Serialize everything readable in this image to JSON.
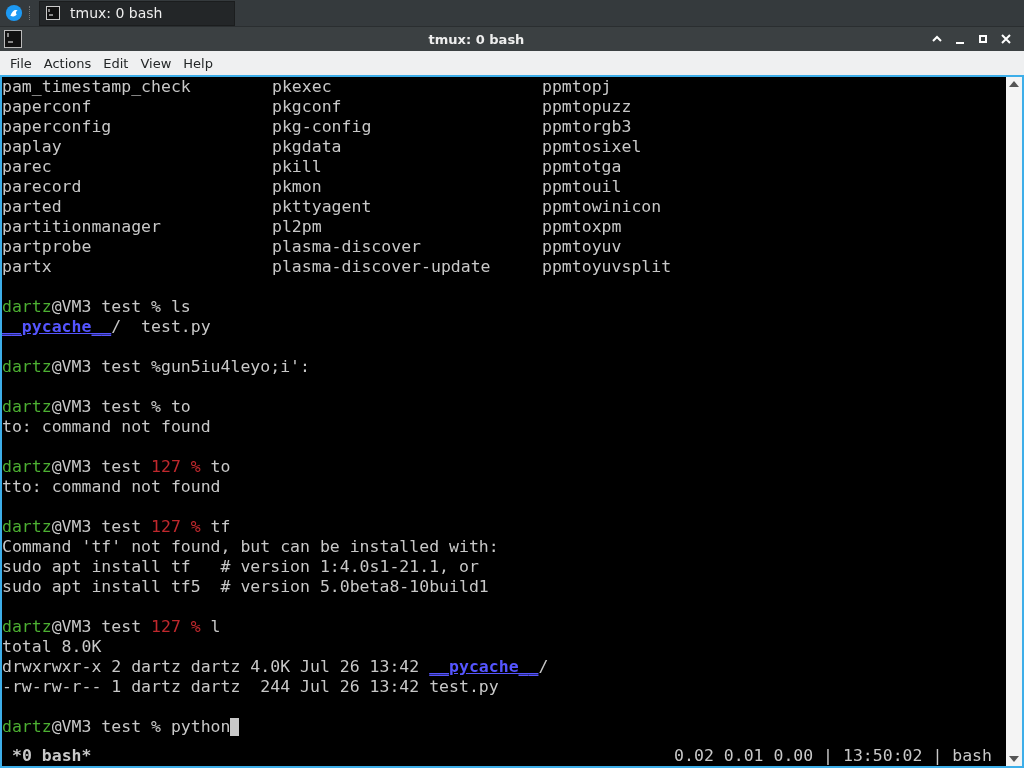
{
  "taskbar": {
    "task": {
      "label": "tmux: 0 bash",
      "selected": true
    }
  },
  "window": {
    "title": "tmux: 0 bash"
  },
  "menu": [
    "File",
    "Actions",
    "Edit",
    "View",
    "Help"
  ],
  "listing": [
    [
      "pam_timestamp_check",
      "pkexec",
      "ppmtopj"
    ],
    [
      "paperconf",
      "pkgconf",
      "ppmtopuzz"
    ],
    [
      "paperconfig",
      "pkg-config",
      "ppmtorgb3"
    ],
    [
      "paplay",
      "pkgdata",
      "ppmtosixel"
    ],
    [
      "parec",
      "pkill",
      "ppmtotga"
    ],
    [
      "parecord",
      "pkmon",
      "ppmtouil"
    ],
    [
      "parted",
      "pkttyagent",
      "ppmtowinicon"
    ],
    [
      "partitionmanager",
      "pl2pm",
      "ppmtoxpm"
    ],
    [
      "partprobe",
      "plasma-discover",
      "ppmtoyuv"
    ],
    [
      "partx",
      "plasma-discover-update",
      "ppmtoyuvsplit"
    ]
  ],
  "lines": [
    {
      "kind": "blank"
    },
    {
      "kind": "text",
      "segments": [
        {
          "kind": "user",
          "text": "dartz"
        },
        {
          "kind": "plain",
          "text": "@VM3 test % ls"
        }
      ]
    },
    {
      "kind": "text",
      "segments": [
        {
          "kind": "dir",
          "text": "__pycache__"
        },
        {
          "kind": "plain",
          "text": "/  test.py"
        }
      ]
    },
    {
      "kind": "blank"
    },
    {
      "kind": "text",
      "segments": [
        {
          "kind": "user",
          "text": "dartz"
        },
        {
          "kind": "plain",
          "text": "@VM3 test %gun5iu4leyo;i':"
        }
      ]
    },
    {
      "kind": "blank"
    },
    {
      "kind": "text",
      "segments": [
        {
          "kind": "user",
          "text": "dartz"
        },
        {
          "kind": "plain",
          "text": "@VM3 test % to"
        }
      ]
    },
    {
      "kind": "text",
      "segments": [
        {
          "kind": "plain",
          "text": "to: command not found"
        }
      ]
    },
    {
      "kind": "blank"
    },
    {
      "kind": "text",
      "segments": [
        {
          "kind": "user",
          "text": "dartz"
        },
        {
          "kind": "plain",
          "text": "@VM3 test "
        },
        {
          "kind": "error",
          "text": "127 %"
        },
        {
          "kind": "plain",
          "text": " to"
        }
      ]
    },
    {
      "kind": "text",
      "segments": [
        {
          "kind": "plain",
          "text": "tto: command not found"
        }
      ]
    },
    {
      "kind": "blank"
    },
    {
      "kind": "text",
      "segments": [
        {
          "kind": "user",
          "text": "dartz"
        },
        {
          "kind": "plain",
          "text": "@VM3 test "
        },
        {
          "kind": "error",
          "text": "127 %"
        },
        {
          "kind": "plain",
          "text": " tf"
        }
      ]
    },
    {
      "kind": "text",
      "segments": [
        {
          "kind": "plain",
          "text": "Command 'tf' not found, but can be installed with:"
        }
      ]
    },
    {
      "kind": "text",
      "segments": [
        {
          "kind": "plain",
          "text": "sudo apt install tf   # version 1:4.0s1-21.1, or"
        }
      ]
    },
    {
      "kind": "text",
      "segments": [
        {
          "kind": "plain",
          "text": "sudo apt install tf5  # version 5.0beta8-10build1"
        }
      ]
    },
    {
      "kind": "blank"
    },
    {
      "kind": "text",
      "segments": [
        {
          "kind": "user",
          "text": "dartz"
        },
        {
          "kind": "plain",
          "text": "@VM3 test "
        },
        {
          "kind": "error",
          "text": "127 %"
        },
        {
          "kind": "plain",
          "text": " l"
        }
      ]
    },
    {
      "kind": "text",
      "segments": [
        {
          "kind": "plain",
          "text": "total 8.0K"
        }
      ]
    },
    {
      "kind": "text",
      "segments": [
        {
          "kind": "plain",
          "text": "drwxrwxr-x 2 dartz dartz 4.0K Jul 26 13:42 "
        },
        {
          "kind": "dir",
          "text": "__pycache__"
        },
        {
          "kind": "plain",
          "text": "/"
        }
      ]
    },
    {
      "kind": "text",
      "segments": [
        {
          "kind": "plain",
          "text": "-rw-rw-r-- 1 dartz dartz  244 Jul 26 13:42 test.py"
        }
      ]
    },
    {
      "kind": "blank"
    },
    {
      "kind": "input",
      "segments": [
        {
          "kind": "user",
          "text": "dartz"
        },
        {
          "kind": "plain",
          "text": "@VM3 test % python"
        }
      ]
    }
  ],
  "status_bar": {
    "window": "*0 bash*",
    "info": "0.02 0.01 0.00 | 13:50:02 | bash"
  }
}
